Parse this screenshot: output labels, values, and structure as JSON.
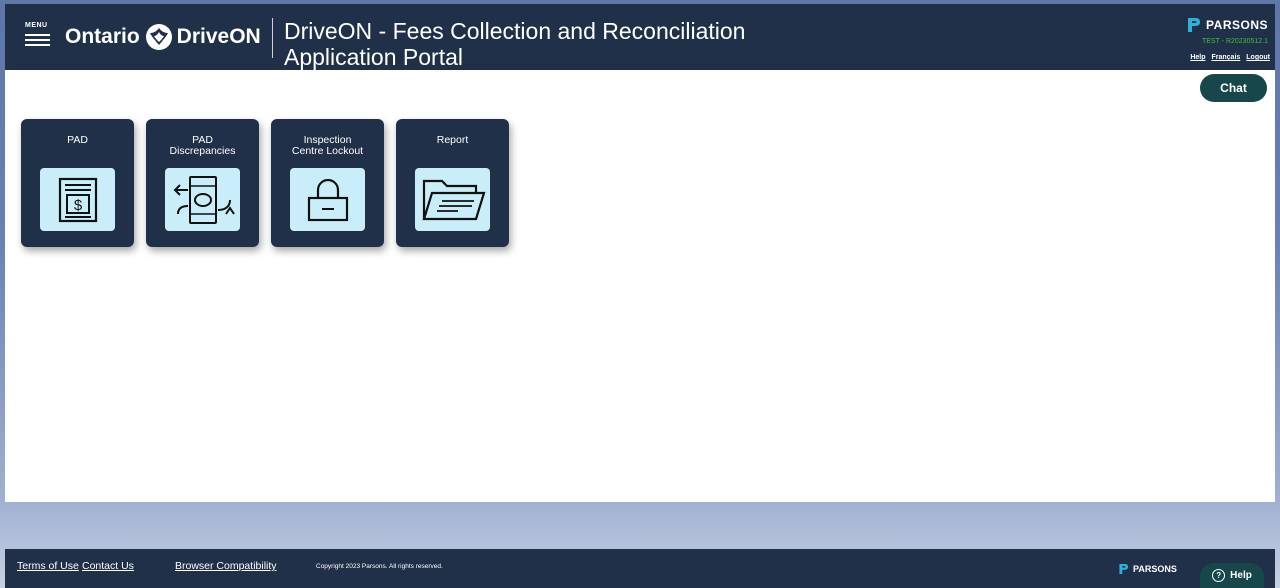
{
  "header": {
    "menu_label": "MENU",
    "logo_left": "Ontario",
    "logo_right": "DriveON",
    "title_line1": "DriveON -  Fees Collection and Reconciliation",
    "title_line2": "Application Portal",
    "brand": "PARSONS",
    "env_tag": "TEST - R20230512.1",
    "links": {
      "help": "Help",
      "francais": "Français",
      "logout": "Logout"
    }
  },
  "chat": {
    "label": "Chat"
  },
  "tiles": [
    {
      "label": "PAD",
      "icon": "money-document-icon"
    },
    {
      "label": "PAD\nDiscrepancies",
      "icon": "money-exchange-icon"
    },
    {
      "label": "Inspection\nCentre Lockout",
      "icon": "lock-icon"
    },
    {
      "label": "Report",
      "icon": "folder-icon"
    }
  ],
  "footer": {
    "terms": "Terms of Use",
    "contact": "Contact Us",
    "browser": "Browser Compatibility",
    "copyright": "Copyright 2023 Parsons. All rights reserved.",
    "brand": "PARSONS",
    "help_label": "Help"
  },
  "colors": {
    "header_bg": "#1f3048",
    "accent_green": "#17474a",
    "tile_icon_bg": "#c9eef9",
    "env_tag": "#3fbf3f"
  }
}
